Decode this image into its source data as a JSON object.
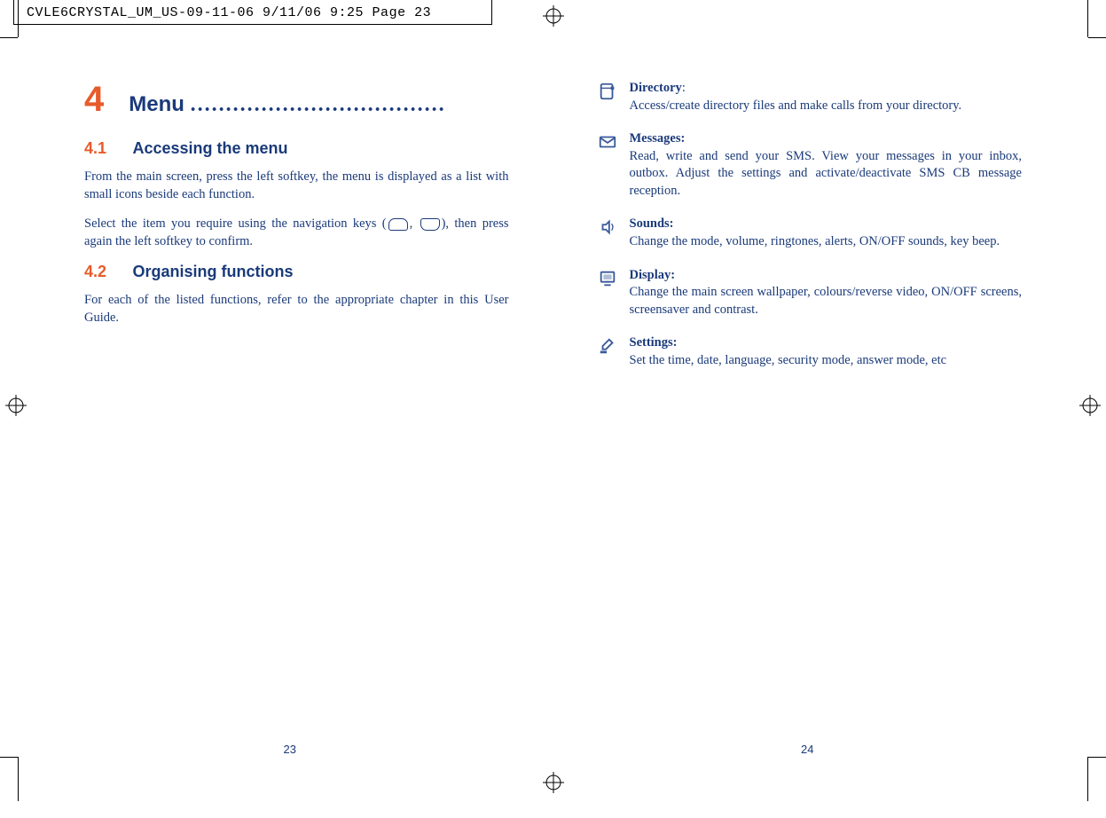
{
  "print_header": "CVLE6CRYSTAL_UM_US-09-11-06  9/11/06  9:25  Page 23",
  "left": {
    "chapter_number": "4",
    "chapter_title": "Menu ",
    "chapter_dots": "....................................",
    "s1_num": "4.1",
    "s1_title": "Accessing the menu",
    "s1_p1": "From the main screen, press the left softkey, the menu is displayed as a list with small icons beside each function.",
    "s1_p2a": "Select the item you require using the navigation keys (",
    "s1_p2b": ", ",
    "s1_p2c": "), then press again the left softkey to confirm.",
    "s2_num": "4.2",
    "s2_title": "Organising functions",
    "s2_p1": "For each of the listed functions, refer to the appropriate chapter in this User Guide.",
    "page_num": "23"
  },
  "right": {
    "functions": {
      "directory": {
        "title": "Directory",
        "sep": ":",
        "desc": "Access/create directory files and make calls from your directory."
      },
      "messages": {
        "title": "Messages:",
        "desc": "Read, write and send your SMS. View your messages in your inbox, outbox. Adjust the settings and activate/deactivate SMS CB message reception."
      },
      "sounds": {
        "title": "Sounds:",
        "desc": "Change the mode, volume, ringtones, alerts, ON/OFF sounds, key beep."
      },
      "display": {
        "title": "Display:",
        "desc": "Change the main screen wallpaper, colours/reverse video, ON/OFF screens, screensaver and contrast."
      },
      "settings": {
        "title": "Settings:",
        "desc": "Set the time, date, language, security mode, answer mode, etc"
      }
    },
    "page_num": "24"
  }
}
